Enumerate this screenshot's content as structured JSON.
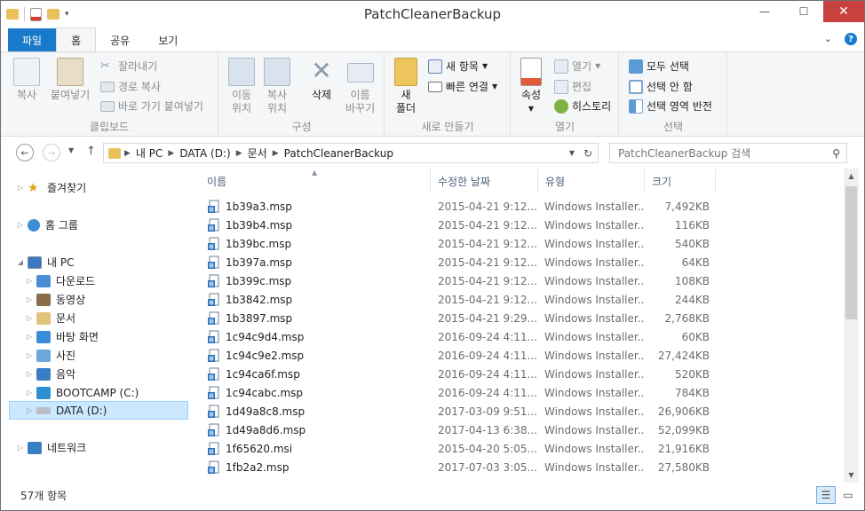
{
  "window": {
    "title": "PatchCleanerBackup",
    "minimize": "—",
    "maximize": "☐",
    "close": "✕"
  },
  "tabs": [
    {
      "label": "파일"
    },
    {
      "label": "홈"
    },
    {
      "label": "공유"
    },
    {
      "label": "보기"
    }
  ],
  "ribbon": {
    "clipboard": {
      "label": "클립보드",
      "copy": "복사",
      "paste": "붙여넣기",
      "cut": "잘라내기",
      "copy_path": "경로 복사",
      "paste_shortcut": "바로 가기 붙여넣기"
    },
    "organize": {
      "label": "구성",
      "move_to_1": "이동",
      "move_to_2": "위치",
      "copy_to_1": "복사",
      "copy_to_2": "위치",
      "delete": "삭제",
      "rename_1": "이름",
      "rename_2": "바꾸기"
    },
    "new": {
      "label": "새로 만들기",
      "new_folder_1": "새",
      "new_folder_2": "폴더",
      "new_item": "새 항목",
      "easy_access": "빠른 연결"
    },
    "open": {
      "label": "열기",
      "properties": "속성",
      "open": "열기",
      "edit": "편집",
      "history": "히스토리"
    },
    "select": {
      "label": "선택",
      "select_all": "모두 선택",
      "select_none": "선택 안 함",
      "invert": "선택 영역 반전"
    }
  },
  "address": {
    "crumbs": [
      "내 PC",
      "DATA (D:)",
      "문서",
      "PatchCleanerBackup"
    ],
    "search_placeholder": "PatchCleanerBackup 검색"
  },
  "nav": {
    "favorites": "즐겨찾기",
    "homegroup": "홈 그룹",
    "this_pc": "내 PC",
    "downloads": "다운로드",
    "videos": "동영상",
    "documents": "문서",
    "desktop": "바탕 화면",
    "pictures": "사진",
    "music": "음악",
    "bootcamp": "BOOTCAMP (C:)",
    "data": "DATA (D:)",
    "network": "네트워크"
  },
  "columns": {
    "name": "이름",
    "date": "수정한 날짜",
    "type": "유형",
    "size": "크기"
  },
  "files": [
    {
      "name": "1b39a3.msp",
      "date": "2015-04-21 9:12...",
      "type": "Windows Installer...",
      "size": "7,492KB"
    },
    {
      "name": "1b39b4.msp",
      "date": "2015-04-21 9:12...",
      "type": "Windows Installer...",
      "size": "116KB"
    },
    {
      "name": "1b39bc.msp",
      "date": "2015-04-21 9:12...",
      "type": "Windows Installer...",
      "size": "540KB"
    },
    {
      "name": "1b397a.msp",
      "date": "2015-04-21 9:12...",
      "type": "Windows Installer...",
      "size": "64KB"
    },
    {
      "name": "1b399c.msp",
      "date": "2015-04-21 9:12...",
      "type": "Windows Installer...",
      "size": "108KB"
    },
    {
      "name": "1b3842.msp",
      "date": "2015-04-21 9:12...",
      "type": "Windows Installer...",
      "size": "244KB"
    },
    {
      "name": "1b3897.msp",
      "date": "2015-04-21 9:29...",
      "type": "Windows Installer...",
      "size": "2,768KB"
    },
    {
      "name": "1c94c9d4.msp",
      "date": "2016-09-24 4:11...",
      "type": "Windows Installer...",
      "size": "60KB"
    },
    {
      "name": "1c94c9e2.msp",
      "date": "2016-09-24 4:11...",
      "type": "Windows Installer...",
      "size": "27,424KB"
    },
    {
      "name": "1c94ca6f.msp",
      "date": "2016-09-24 4:11...",
      "type": "Windows Installer...",
      "size": "520KB"
    },
    {
      "name": "1c94cabc.msp",
      "date": "2016-09-24 4:11...",
      "type": "Windows Installer...",
      "size": "784KB"
    },
    {
      "name": "1d49a8c8.msp",
      "date": "2017-03-09 9:51...",
      "type": "Windows Installer...",
      "size": "26,906KB"
    },
    {
      "name": "1d49a8d6.msp",
      "date": "2017-04-13 6:38...",
      "type": "Windows Installer...",
      "size": "52,099KB"
    },
    {
      "name": "1f65620.msi",
      "date": "2015-04-20 5:05...",
      "type": "Windows Installer...",
      "size": "21,916KB"
    },
    {
      "name": "1fb2a2.msp",
      "date": "2017-07-03 3:05...",
      "type": "Windows Installer...",
      "size": "27,580KB"
    }
  ],
  "status": {
    "count": "57개 항목"
  }
}
